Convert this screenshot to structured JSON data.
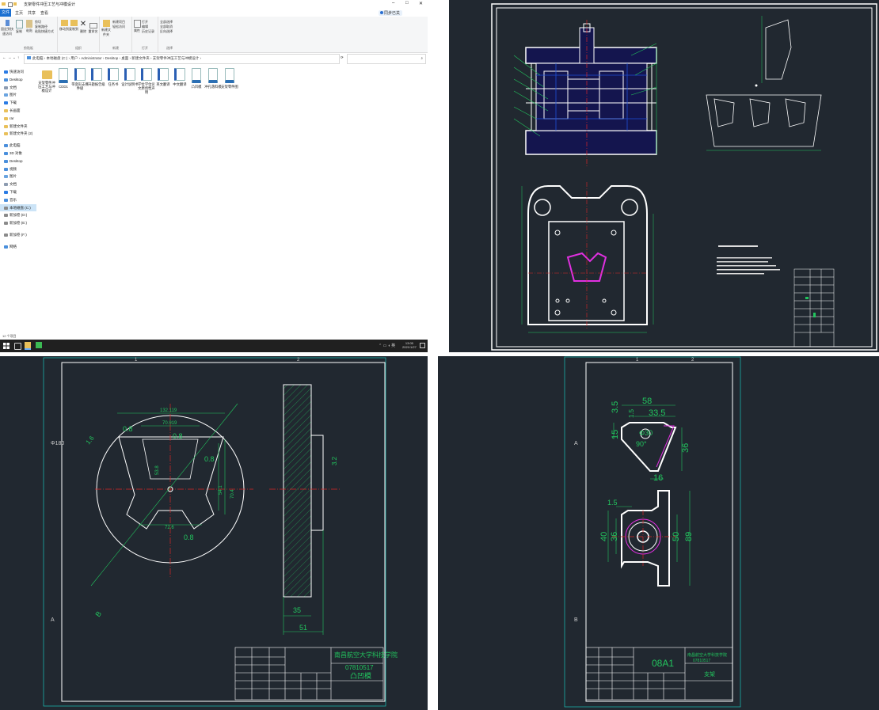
{
  "explorer": {
    "title": "支架零件冲压工艺与冲模设计",
    "tabs": [
      "文件",
      "主页",
      "共享",
      "查看"
    ],
    "ribbon": {
      "clipboard": {
        "pin": "固定到快速访问",
        "copy": "复制",
        "paste": "粘贴",
        "cut": "剪切",
        "copy_path": "复制路径",
        "paste_shortcut": "粘贴快捷方式",
        "label": "剪贴板"
      },
      "organize": {
        "move_to": "移动到",
        "copy_to": "复制到",
        "delete": "删除",
        "rename": "重命名",
        "label": "组织"
      },
      "new": {
        "new_folder": "新建文件夹",
        "new_item": "新建项目",
        "easy_access": "轻松访问",
        "label": "新建"
      },
      "open": {
        "properties": "属性",
        "open": "打开",
        "edit": "编辑",
        "history": "历史记录",
        "label": "打开"
      },
      "select": {
        "select_all": "全部选择",
        "select_none": "全部取消",
        "invert": "反向选择",
        "label": "选择"
      }
    },
    "address": [
      "此电脑",
      "本地磁盘 (C:)",
      "用户",
      "Administrator",
      "Desktop",
      "桌面",
      "新建文件夹",
      "支架零件冲压工艺与冲模设计"
    ],
    "search_placeholder": "",
    "nav": [
      {
        "label": "快速访问",
        "type": "star"
      },
      {
        "label": "Desktop",
        "type": "blue"
      },
      {
        "label": "文档",
        "type": "doc"
      },
      {
        "label": "图片",
        "type": "pic"
      },
      {
        "label": "下载",
        "type": "down"
      },
      {
        "label": "长画面",
        "type": "folder"
      },
      {
        "label": "rar",
        "type": "folder"
      },
      {
        "label": "新建文件夹",
        "type": "folder"
      },
      {
        "label": "新建文件夹 (2)",
        "type": "folder"
      },
      {
        "label": "",
        "type": "gap"
      },
      {
        "label": "此电脑",
        "type": "pc"
      },
      {
        "label": "3D 对象",
        "type": "blue"
      },
      {
        "label": "Desktop",
        "type": "blue"
      },
      {
        "label": "视频",
        "type": "blue"
      },
      {
        "label": "图片",
        "type": "pic"
      },
      {
        "label": "文档",
        "type": "doc"
      },
      {
        "label": "下载",
        "type": "down"
      },
      {
        "label": "音乐",
        "type": "blue"
      },
      {
        "label": "本地磁盘 (C:)",
        "type": "drive"
      },
      {
        "label": "新加卷 (D:)",
        "type": "drive"
      },
      {
        "label": "新加卷 (E:)",
        "type": "drive"
      },
      {
        "label": "",
        "type": "gap"
      },
      {
        "label": "新加卷 (F:)",
        "type": "drive"
      },
      {
        "label": "",
        "type": "gap"
      },
      {
        "label": "网络",
        "type": "net"
      }
    ],
    "files": [
      {
        "name": "支架零件冲压工艺与冲模设计",
        "kind": "folder"
      },
      {
        "name": "CDD1",
        "kind": "dwg"
      },
      {
        "name": "带变形支撑件级",
        "kind": "doc"
      },
      {
        "name": "开题报告级",
        "kind": "doc"
      },
      {
        "name": "任务书",
        "kind": "doc"
      },
      {
        "name": "设计说明书",
        "kind": "doc"
      },
      {
        "name": "学位学位论文原创性声明",
        "kind": "doc"
      },
      {
        "name": "英文翻译",
        "kind": "doc"
      },
      {
        "name": "中文翻译",
        "kind": "doc"
      },
      {
        "name": "凸凹模",
        "kind": "dwg"
      },
      {
        "name": "冲孔落料模",
        "kind": "dwg"
      },
      {
        "name": "支架零件图",
        "kind": "dwg"
      }
    ],
    "status": "12 个项目",
    "clock_time": "13:05",
    "clock_date": "2021/1/27",
    "sign_in": "同步已关"
  },
  "drawing2": {
    "school": "南昌航空大学科技学院",
    "student_id": "07810517",
    "part_name": "凸凹模",
    "dims": [
      "132.119",
      "70.919",
      "0.8",
      "0.8",
      "0.8",
      "0.8",
      "72.6",
      "70.4",
      "54.1",
      "53.8",
      "1.6",
      "3.2",
      "35",
      "51",
      "Φ180",
      "A",
      "B",
      "1",
      "2"
    ]
  },
  "drawing3": {
    "code": "08A1",
    "school": "南昌航空大学科技学院",
    "student_id": "07810517",
    "part_name": "支架",
    "dims": [
      "58",
      "33.5",
      "3.5",
      "1.5",
      "15",
      "Φ30",
      "90°",
      "36",
      "16",
      "1.5",
      "40",
      "36",
      "50",
      "89",
      "A",
      "B",
      "1",
      "2"
    ]
  },
  "colors": {
    "cad_bg": "#212830",
    "cad_line": "#ffffff",
    "cad_dim": "#22c55e",
    "cad_center": "#dc2626",
    "cad_pink": "#e030e0",
    "cad_frame": "#19c3b8"
  }
}
